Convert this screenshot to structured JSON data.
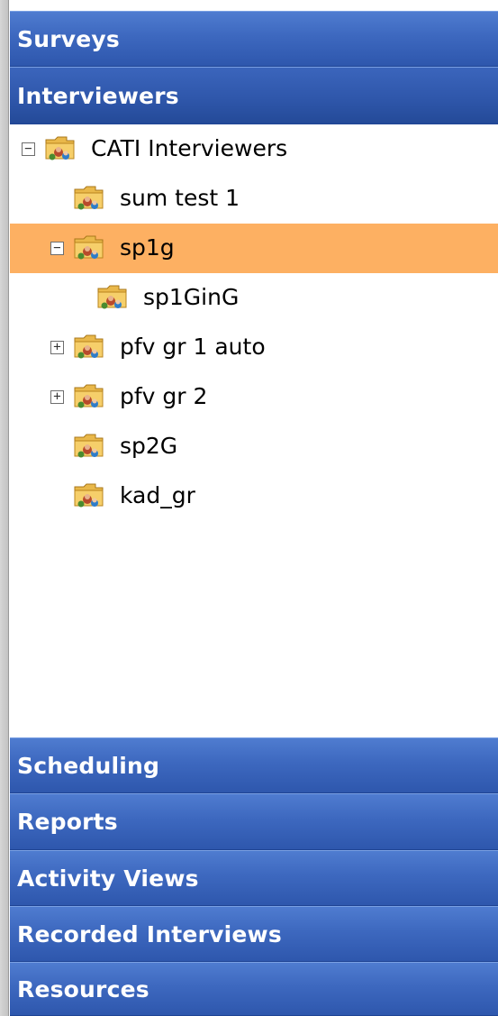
{
  "panels": {
    "surveys": "Surveys",
    "interviewers": "Interviewers",
    "scheduling": "Scheduling",
    "reports": "Reports",
    "activity_views": "Activity Views",
    "recorded_interviews": "Recorded Interviews",
    "resources": "Resources"
  },
  "tree": {
    "nodes": [
      {
        "label": "CATI Interviewers",
        "expander": "−",
        "selected": false
      },
      {
        "label": "sum test 1",
        "expander": "",
        "selected": false
      },
      {
        "label": "sp1g",
        "expander": "−",
        "selected": true
      },
      {
        "label": "sp1GinG",
        "expander": "",
        "selected": false
      },
      {
        "label": "pfv gr 1 auto",
        "expander": "+",
        "selected": false
      },
      {
        "label": "pfv gr 2",
        "expander": "+",
        "selected": false
      },
      {
        "label": "sp2G",
        "expander": "",
        "selected": false
      },
      {
        "label": "kad_gr",
        "expander": "",
        "selected": false
      }
    ],
    "icon": "group-folder-icon"
  },
  "colors": {
    "header_blue": "#3d68bf",
    "selected_row": "#fdb062"
  }
}
